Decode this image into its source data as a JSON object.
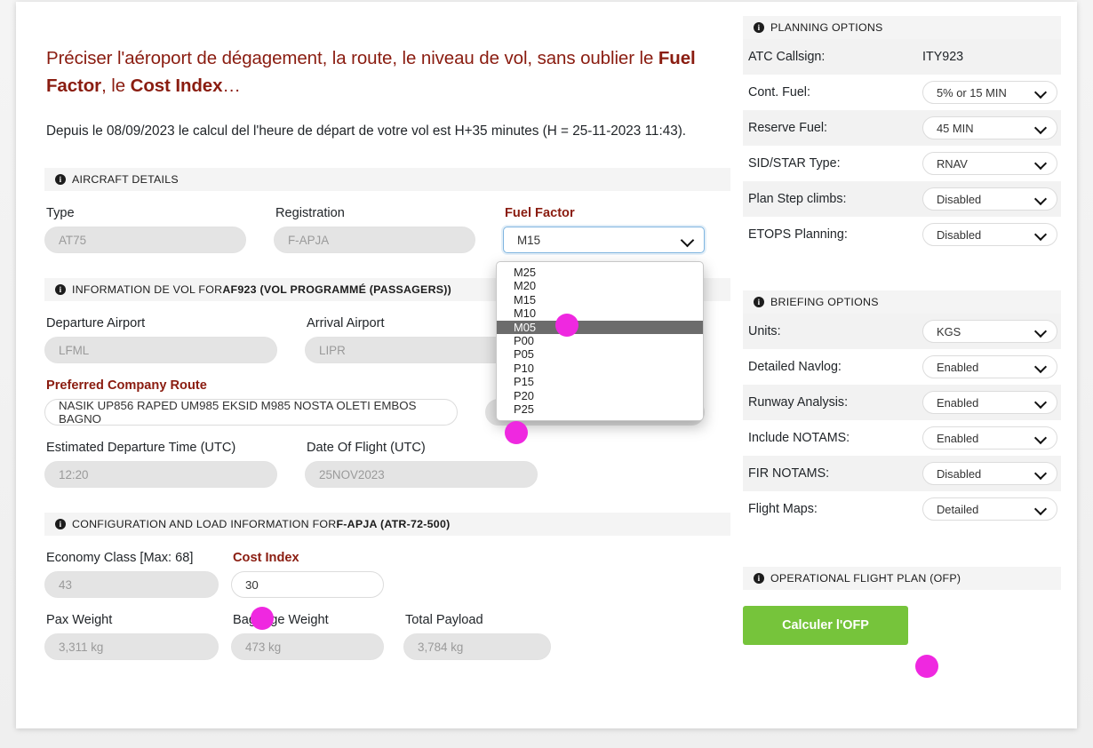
{
  "intro": {
    "title_pre": "Préciser l'aéroport de dégagement, la route, le niveau de vol, sans oublier le ",
    "title_b1": "Fuel Factor",
    "title_mid": ", le ",
    "title_b2": "Cost Index",
    "title_end": "…",
    "subtitle": "Depuis le 08/09/2023 le calcul del l'heure de départ de votre vol est H+35 minutes (H = 25-11-2023 11:43)."
  },
  "aircraft_section": {
    "heading": "AIRCRAFT DETAILS",
    "type_label": "Type",
    "type_value": "AT75",
    "registration_label": "Registration",
    "registration_value": "F-APJA",
    "fuel_factor_label": "Fuel Factor",
    "fuel_factor_value": "M15",
    "fuel_factor_options": [
      "M25",
      "M20",
      "M15",
      "M10",
      "M05",
      "P00",
      "P05",
      "P10",
      "P15",
      "P20",
      "P25"
    ],
    "fuel_factor_highlighted": "M05"
  },
  "flight_section": {
    "heading_pre": "INFORMATION DE VOL FOR ",
    "heading_bold": "AF923 (VOL PROGRAMMÉ (PASSAGERS))",
    "departure_label": "Departure Airport",
    "departure_value": "LFML",
    "arrival_label": "Arrival Airport",
    "arrival_value": "LIPR",
    "route_label": "Preferred Company Route",
    "route_value": "NASIK UP856 RAPED UM985 EKSID M985 NOSTA OLETI EMBOS BAGNO",
    "edt_label": "Estimated Departure Time (UTC)",
    "edt_value": "12:20",
    "dof_label": "Date Of Flight (UTC)",
    "dof_value": "25NOV2023"
  },
  "config_section": {
    "heading_pre": "CONFIGURATION AND LOAD INFORMATION FOR ",
    "heading_bold": "F-APJA (ATR-72-500)",
    "economy_label": "Economy Class [Max: 68]",
    "economy_value": "43",
    "cost_index_label": "Cost Index",
    "cost_index_value": "30",
    "pax_weight_label": "Pax Weight",
    "pax_weight_value": "3,311 kg",
    "baggage_weight_label": "Baggage Weight",
    "baggage_weight_value": "473 kg",
    "total_payload_label": "Total Payload",
    "total_payload_value": "3,784 kg"
  },
  "planning_options": {
    "heading": "PLANNING OPTIONS",
    "rows": [
      {
        "label": "ATC Callsign:",
        "value": "ITY923",
        "type": "text"
      },
      {
        "label": "Cont. Fuel:",
        "value": "5% or 15 MIN",
        "type": "select"
      },
      {
        "label": "Reserve Fuel:",
        "value": "45 MIN",
        "type": "select"
      },
      {
        "label": "SID/STAR Type:",
        "value": "RNAV",
        "type": "select"
      },
      {
        "label": "Plan Step climbs:",
        "value": "Disabled",
        "type": "select"
      },
      {
        "label": "ETOPS Planning:",
        "value": "Disabled",
        "type": "select"
      }
    ]
  },
  "briefing_options": {
    "heading": "BRIEFING OPTIONS",
    "rows": [
      {
        "label": "Units:",
        "value": "KGS"
      },
      {
        "label": "Detailed Navlog:",
        "value": "Enabled"
      },
      {
        "label": "Runway Analysis:",
        "value": "Enabled"
      },
      {
        "label": "Include NOTAMS:",
        "value": "Enabled"
      },
      {
        "label": "FIR NOTAMS:",
        "value": "Disabled"
      },
      {
        "label": "Flight Maps:",
        "value": "Detailed"
      }
    ]
  },
  "ofp_section": {
    "heading": "OPERATIONAL FLIGHT PLAN (OFP)",
    "button_label": "Calculer l'OFP"
  },
  "colors": {
    "accent_red": "#8a1c10",
    "button_green": "#76c43b",
    "marker_magenta": "#ef28e0",
    "selected_option_gray": "#6c6c6c"
  },
  "icons": {
    "info": "i"
  }
}
